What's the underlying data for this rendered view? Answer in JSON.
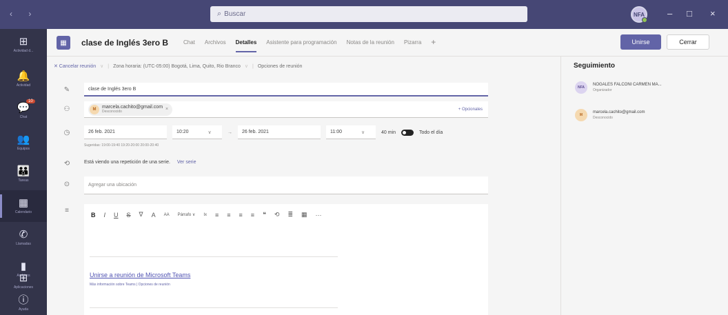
{
  "titlebar": {
    "nav": "‹ ›",
    "search_placeholder": "Buscar",
    "avatar_initials": "NFA",
    "minimize": "–",
    "maximize": "□",
    "close": "×"
  },
  "rail": [
    {
      "name": "activity",
      "glyph": "⊞",
      "label": "Actividad d..."
    },
    {
      "name": "activity2",
      "glyph": "🔔",
      "label": "Actividad"
    },
    {
      "name": "chat",
      "glyph": "💬",
      "label": "Chat",
      "badge": "10"
    },
    {
      "name": "teams",
      "glyph": "👥",
      "label": "Equipos"
    },
    {
      "name": "assignments",
      "glyph": "👪",
      "label": "Tareas"
    },
    {
      "name": "calendar",
      "glyph": "▦",
      "label": "Calendario"
    },
    {
      "name": "calls",
      "glyph": "✆",
      "label": "Llamadas"
    },
    {
      "name": "files",
      "glyph": "▮",
      "label": "Archivos"
    },
    {
      "name": "more",
      "glyph": "···",
      "label": ""
    },
    {
      "name": "apps",
      "glyph": "⊞",
      "label": "Aplicaciones"
    },
    {
      "name": "help",
      "glyph": "ⓘ",
      "label": "Ayuda"
    }
  ],
  "header": {
    "meeting_icon": "▦",
    "title": "clase de Inglés 3ero B",
    "tabs": [
      "Chat",
      "Archivos",
      "Detalles",
      "Asistente para programación",
      "Notas de la reunión",
      "Pizarra"
    ],
    "active_tab": "Detalles",
    "add_tab": "+",
    "join_label": "Unirse",
    "close_label": "Cerrar"
  },
  "toolbar": {
    "cancel": "✕ Cancelar reunión",
    "timezone": "Zona horaria: (UTC-05:00) Bogotá, Lima, Quito, Rio Branco",
    "options": "Opciones de reunión"
  },
  "form": {
    "title_value": "clase de Inglés 3ero B",
    "attendee": {
      "initials": "M",
      "email": "marcela.cachito@gmail.com",
      "status": "Desconocido"
    },
    "optional_label": "+ Opcionales",
    "start_date": "26 feb. 2021",
    "start_time": "10:20",
    "end_date": "26 feb. 2021",
    "end_time": "11:00",
    "duration": "40 min",
    "all_day": "Todo el día",
    "hint": "Sugeridas: 19:00-19:40  19:20-20:00  20:00-20:40",
    "repeat_text": "Está viendo una repetición de una serie.",
    "repeat_link": "Ver serie",
    "location_placeholder": "Agregar una ubicación",
    "editor_tools": [
      "B",
      "I",
      "U",
      "S",
      "∇",
      "A",
      "AA",
      "Párrafo ∨",
      "Ix",
      "≡",
      "≡",
      "≡",
      "≡",
      "❝",
      "⟲",
      "≣",
      "▦",
      "···"
    ],
    "join_link": "Unirse a reunión de Microsoft Teams",
    "join_sub": "Más información sobre Teams | Opciones de reunión"
  },
  "tracking": {
    "title": "Seguimiento",
    "people": [
      {
        "initials": "NFA",
        "name": "NOGALES FALCONI CARMEN MA...",
        "role": "Organizador",
        "bg": "#dcd4f0",
        "fg": "#5b4d8f"
      },
      {
        "initials": "M",
        "name": "marcela.cachito@gmail.com",
        "role": "Desconocido",
        "bg": "#f5d9b0",
        "fg": "#b5651d"
      }
    ]
  }
}
